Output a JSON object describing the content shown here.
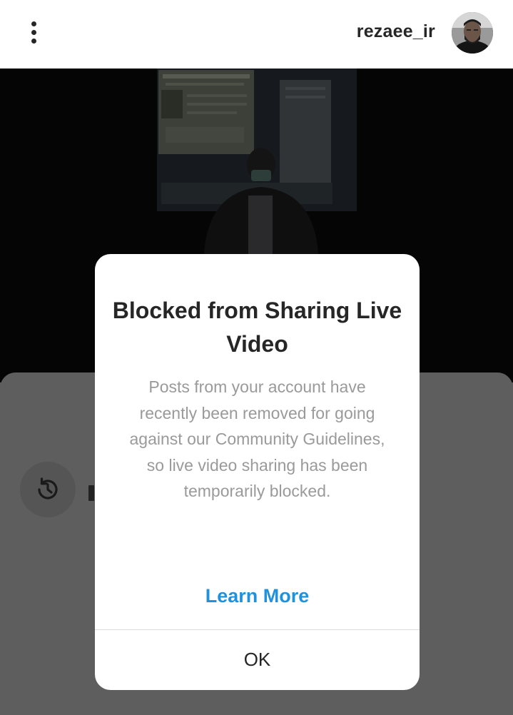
{
  "header": {
    "username": "rezaee_ir"
  },
  "dialog": {
    "title": "Blocked from Sharing Live Video",
    "body": "Posts from your account have recently been removed for going against our Community Guidelines, so live video sharing has been temporarily blocked.",
    "learn_more_label": "Learn More",
    "ok_label": "OK"
  },
  "icons": {
    "menu": "more-vertical-icon",
    "history": "history-icon"
  },
  "colors": {
    "link_blue": "#1f92dd",
    "title_text": "#262626",
    "body_text": "#9a9a9a",
    "overlay_gray": "#5e5e5e"
  }
}
